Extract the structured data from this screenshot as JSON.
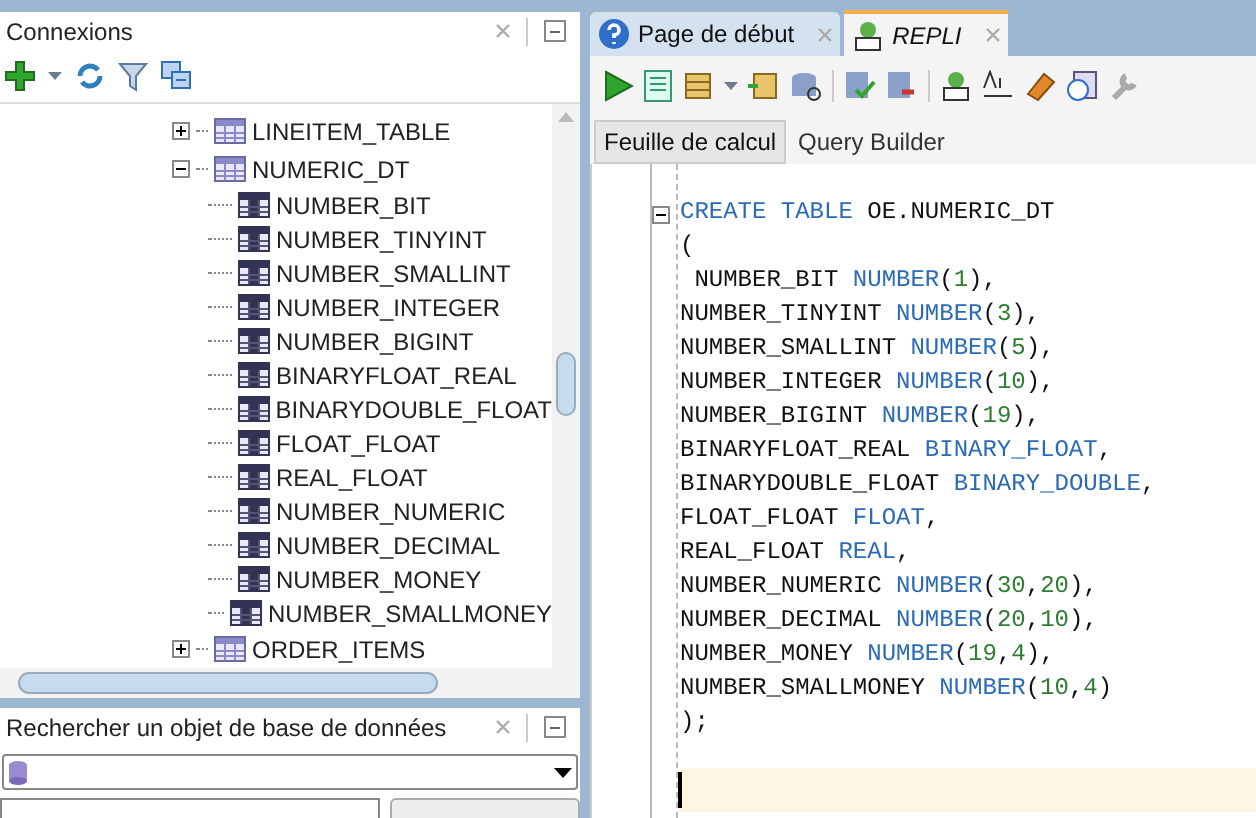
{
  "connections_panel": {
    "title": "Connexions",
    "tree": [
      {
        "label": "LINEITEM_TABLE",
        "expanded": false
      },
      {
        "label": "NUMERIC_DT",
        "expanded": true,
        "children": [
          {
            "label": "NUMBER_BIT"
          },
          {
            "label": "NUMBER_TINYINT"
          },
          {
            "label": "NUMBER_SMALLINT"
          },
          {
            "label": "NUMBER_INTEGER"
          },
          {
            "label": "NUMBER_BIGINT"
          },
          {
            "label": "BINARYFLOAT_REAL"
          },
          {
            "label": "BINARYDOUBLE_FLOAT"
          },
          {
            "label": "FLOAT_FLOAT"
          },
          {
            "label": "REAL_FLOAT"
          },
          {
            "label": "NUMBER_NUMERIC"
          },
          {
            "label": "NUMBER_DECIMAL"
          },
          {
            "label": "NUMBER_MONEY"
          },
          {
            "label": "NUMBER_SMALLMONEY"
          }
        ]
      },
      {
        "label": "ORDER_ITEMS",
        "expanded": false
      }
    ]
  },
  "search_panel": {
    "title": "Rechercher un objet de base de données"
  },
  "editor_tabs": [
    {
      "label": "Page de début",
      "selected": false
    },
    {
      "label": "REPLI",
      "selected": true
    }
  ],
  "sub_tabs": [
    {
      "label": "Feuille de calcul",
      "selected": true
    },
    {
      "label": "Query Builder",
      "selected": false
    }
  ],
  "code_lines": [
    [
      {
        "kind": "kw",
        "text": "CREATE TABLE "
      },
      {
        "kind": "id",
        "text": "OE.NUMERIC_DT"
      }
    ],
    [
      {
        "kind": "id",
        "text": "("
      }
    ],
    [
      {
        "kind": "id",
        "text": " NUMBER_BIT "
      },
      {
        "kind": "kw",
        "text": "NUMBER"
      },
      {
        "kind": "id",
        "text": "("
      },
      {
        "kind": "num",
        "text": "1"
      },
      {
        "kind": "id",
        "text": "),"
      }
    ],
    [
      {
        "kind": "id",
        "text": "NUMBER_TINYINT "
      },
      {
        "kind": "kw",
        "text": "NUMBER"
      },
      {
        "kind": "id",
        "text": "("
      },
      {
        "kind": "num",
        "text": "3"
      },
      {
        "kind": "id",
        "text": "),"
      }
    ],
    [
      {
        "kind": "id",
        "text": "NUMBER_SMALLINT "
      },
      {
        "kind": "kw",
        "text": "NUMBER"
      },
      {
        "kind": "id",
        "text": "("
      },
      {
        "kind": "num",
        "text": "5"
      },
      {
        "kind": "id",
        "text": "),"
      }
    ],
    [
      {
        "kind": "id",
        "text": "NUMBER_INTEGER "
      },
      {
        "kind": "kw",
        "text": "NUMBER"
      },
      {
        "kind": "id",
        "text": "("
      },
      {
        "kind": "num",
        "text": "10"
      },
      {
        "kind": "id",
        "text": "),"
      }
    ],
    [
      {
        "kind": "id",
        "text": "NUMBER_BIGINT "
      },
      {
        "kind": "kw",
        "text": "NUMBER"
      },
      {
        "kind": "id",
        "text": "("
      },
      {
        "kind": "num",
        "text": "19"
      },
      {
        "kind": "id",
        "text": "),"
      }
    ],
    [
      {
        "kind": "id",
        "text": "BINARYFLOAT_REAL "
      },
      {
        "kind": "kw",
        "text": "BINARY_FLOAT"
      },
      {
        "kind": "id",
        "text": ","
      }
    ],
    [
      {
        "kind": "id",
        "text": "BINARYDOUBLE_FLOAT "
      },
      {
        "kind": "kw",
        "text": "BINARY_DOUBLE"
      },
      {
        "kind": "id",
        "text": ","
      }
    ],
    [
      {
        "kind": "id",
        "text": "FLOAT_FLOAT "
      },
      {
        "kind": "kw",
        "text": "FLOAT"
      },
      {
        "kind": "id",
        "text": ","
      }
    ],
    [
      {
        "kind": "id",
        "text": "REAL_FLOAT "
      },
      {
        "kind": "kw",
        "text": "REAL"
      },
      {
        "kind": "id",
        "text": ","
      }
    ],
    [
      {
        "kind": "id",
        "text": "NUMBER_NUMERIC "
      },
      {
        "kind": "kw",
        "text": "NUMBER"
      },
      {
        "kind": "id",
        "text": "("
      },
      {
        "kind": "num",
        "text": "30"
      },
      {
        "kind": "id",
        "text": ","
      },
      {
        "kind": "num",
        "text": "20"
      },
      {
        "kind": "id",
        "text": "),"
      }
    ],
    [
      {
        "kind": "id",
        "text": "NUMBER_DECIMAL "
      },
      {
        "kind": "kw",
        "text": "NUMBER"
      },
      {
        "kind": "id",
        "text": "("
      },
      {
        "kind": "num",
        "text": "20"
      },
      {
        "kind": "id",
        "text": ","
      },
      {
        "kind": "num",
        "text": "10"
      },
      {
        "kind": "id",
        "text": "),"
      }
    ],
    [
      {
        "kind": "id",
        "text": "NUMBER_MONEY "
      },
      {
        "kind": "kw",
        "text": "NUMBER"
      },
      {
        "kind": "id",
        "text": "("
      },
      {
        "kind": "num",
        "text": "19"
      },
      {
        "kind": "id",
        "text": ","
      },
      {
        "kind": "num",
        "text": "4"
      },
      {
        "kind": "id",
        "text": "),"
      }
    ],
    [
      {
        "kind": "id",
        "text": "NUMBER_SMALLMONEY "
      },
      {
        "kind": "kw",
        "text": "NUMBER"
      },
      {
        "kind": "id",
        "text": "("
      },
      {
        "kind": "num",
        "text": "10"
      },
      {
        "kind": "id",
        "text": ","
      },
      {
        "kind": "num",
        "text": "4"
      },
      {
        "kind": "id",
        "text": ")"
      }
    ],
    [
      {
        "kind": "id",
        "text": ");"
      }
    ]
  ]
}
